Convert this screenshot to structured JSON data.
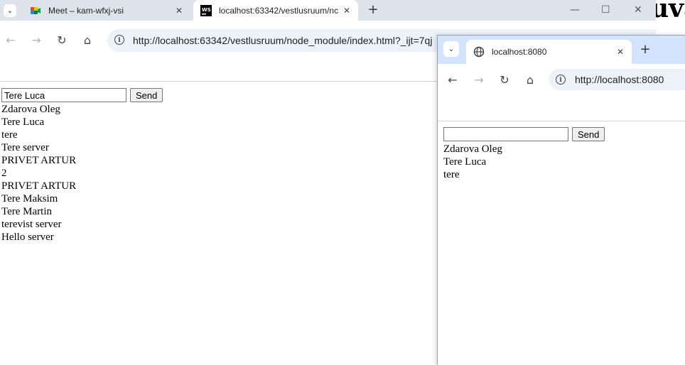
{
  "background_window": {
    "heading_fragment": "uva"
  },
  "main_window": {
    "tab_list_icon": "chevron-down-icon",
    "tabs": [
      {
        "title": "Meet – kam-wfxj-vsi",
        "favicon": "google-meet-icon",
        "active": false,
        "close": "✕"
      },
      {
        "title": "localhost:63342/vestlusruum/nc",
        "favicon": "webstorm-icon",
        "favicon_text": "WS",
        "active": true,
        "close": "✕"
      }
    ],
    "new_tab": "+",
    "window_controls": {
      "minimize": "—",
      "maximize": "☐",
      "close": "✕"
    },
    "nav": {
      "back": "←",
      "forward": "→",
      "reload": "↻",
      "home": "⌂"
    },
    "address_bar": {
      "info_icon": "info-icon",
      "url": "http://localhost:63342/vestlusruum/node_module/index.html?_ijt=7qj"
    },
    "page": {
      "input_value": "Tere Luca",
      "send_label": "Send",
      "messages": [
        "Zdarova Oleg",
        "Tere Luca",
        "tere",
        "Tere server",
        "PRIVET ARTUR",
        "2",
        "PRIVET ARTUR",
        "Tere Maksim",
        "Tere Martin",
        "terevist server",
        "Hello server"
      ]
    }
  },
  "popup_window": {
    "tab_list_icon": "chevron-down-icon",
    "tabs": [
      {
        "title": "localhost:8080",
        "favicon": "globe-icon",
        "active": true,
        "close": "✕"
      }
    ],
    "new_tab": "+",
    "nav": {
      "back": "←",
      "forward": "→",
      "reload": "↻",
      "home": "⌂"
    },
    "address_bar": {
      "info_icon": "info-icon",
      "url": "http://localhost:8080"
    },
    "page": {
      "input_value": "",
      "send_label": "Send",
      "messages": [
        "Zdarova Oleg",
        "Tere Luca",
        "tere"
      ]
    }
  },
  "colors": {
    "tabstrip": "#dde3ea",
    "popup_tabstrip": "#d3e3fd",
    "omnibox": "#edf2fa"
  }
}
